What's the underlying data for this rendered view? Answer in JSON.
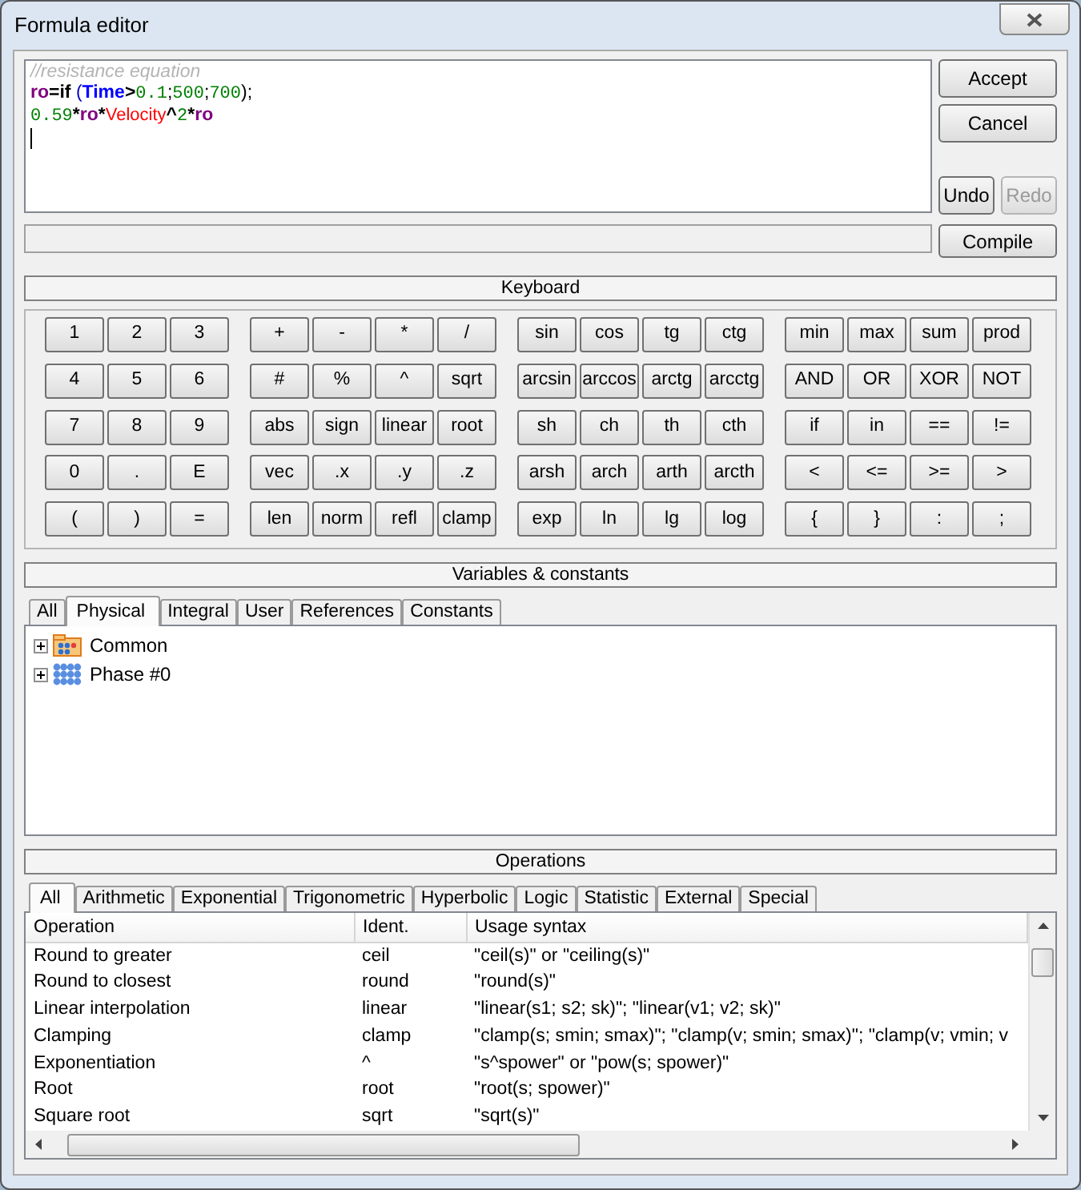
{
  "window": {
    "title": "Formula editor"
  },
  "editor": {
    "lines": [
      [
        {
          "t": "//resistance equation",
          "kind": "comment"
        }
      ],
      [
        {
          "t": "ro",
          "kind": "var"
        },
        {
          "t": "=",
          "kind": "op"
        },
        {
          "t": "if ",
          "kind": "keyword"
        },
        {
          "t": "(",
          "kind": "bracket"
        },
        {
          "t": "Time",
          "kind": "system"
        },
        {
          "t": ">",
          "kind": "op"
        },
        {
          "t": "0.1",
          "kind": "number"
        },
        {
          "t": ";",
          "kind": "sep"
        },
        {
          "t": "500",
          "kind": "number"
        },
        {
          "t": ";",
          "kind": "sep"
        },
        {
          "t": "700",
          "kind": "number"
        },
        {
          "t": ");",
          "kind": "sep"
        }
      ],
      [
        {
          "t": "0.59",
          "kind": "number"
        },
        {
          "t": "*",
          "kind": "op"
        },
        {
          "t": "ro",
          "kind": "var"
        },
        {
          "t": "*",
          "kind": "op"
        },
        {
          "t": "Velocity",
          "kind": "param"
        },
        {
          "t": "^",
          "kind": "op"
        },
        {
          "t": "2",
          "kind": "number"
        },
        {
          "t": "*",
          "kind": "op"
        },
        {
          "t": "ro",
          "kind": "var"
        }
      ]
    ]
  },
  "buttons": {
    "accept": "Accept",
    "cancel": "Cancel",
    "undo": {
      "label": "Undo",
      "disabled": false
    },
    "redo": {
      "label": "Redo",
      "disabled": true
    },
    "compile": "Compile"
  },
  "keyboard": {
    "title": "Keyboard",
    "groups": [
      {
        "rows": [
          [
            "1",
            "2",
            "3"
          ],
          [
            "4",
            "5",
            "6"
          ],
          [
            "7",
            "8",
            "9"
          ],
          [
            "0",
            ".",
            "E"
          ],
          [
            "(",
            ")",
            "="
          ]
        ]
      },
      {
        "rows": [
          [
            "+",
            "-",
            "*",
            "/"
          ],
          [
            "#",
            "%",
            "^",
            "sqrt"
          ],
          [
            "abs",
            "sign",
            "linear",
            "root"
          ],
          [
            "vec",
            ".x",
            ".y",
            ".z"
          ],
          [
            "len",
            "norm",
            "refl",
            "clamp"
          ]
        ]
      },
      {
        "rows": [
          [
            "sin",
            "cos",
            "tg",
            "ctg"
          ],
          [
            "arcsin",
            "arccos",
            "arctg",
            "arcctg"
          ],
          [
            "sh",
            "ch",
            "th",
            "cth"
          ],
          [
            "arsh",
            "arch",
            "arth",
            "arcth"
          ],
          [
            "exp",
            "ln",
            "lg",
            "log"
          ]
        ]
      },
      {
        "rows": [
          [
            "min",
            "max",
            "sum",
            "prod"
          ],
          [
            "AND",
            "OR",
            "XOR",
            "NOT"
          ],
          [
            "if",
            "in",
            "==",
            "!="
          ],
          [
            "<",
            "<=",
            ">=",
            ">"
          ],
          [
            "{",
            "}",
            ":",
            ";"
          ]
        ]
      }
    ]
  },
  "variables": {
    "title": "Variables & constants",
    "tabs": [
      {
        "label": "All",
        "selected": false
      },
      {
        "label": "Physical",
        "selected": true
      },
      {
        "label": "Integral",
        "selected": false
      },
      {
        "label": "User",
        "selected": false
      },
      {
        "label": "References",
        "selected": false
      },
      {
        "label": "Constants",
        "selected": false
      }
    ],
    "tree": [
      {
        "label": "Common",
        "kind": "folder",
        "expanded": false
      },
      {
        "label": "Phase #0",
        "kind": "group",
        "expanded": false
      }
    ]
  },
  "operations": {
    "title": "Operations",
    "tabs": [
      {
        "label": "All",
        "selected": true
      },
      {
        "label": "Arithmetic",
        "selected": false
      },
      {
        "label": "Exponential",
        "selected": false
      },
      {
        "label": "Trigonometric",
        "selected": false
      },
      {
        "label": "Hyperbolic",
        "selected": false
      },
      {
        "label": "Logic",
        "selected": false
      },
      {
        "label": "Statistic",
        "selected": false
      },
      {
        "label": "External",
        "selected": false
      },
      {
        "label": "Special",
        "selected": false
      }
    ],
    "table": {
      "columns": [
        "Operation",
        "Ident.",
        "Usage syntax"
      ],
      "rows": [
        [
          "Round to greater",
          "ceil",
          "\"ceil(s)\" or \"ceiling(s)\""
        ],
        [
          "Round to closest",
          "round",
          "\"round(s)\""
        ],
        [
          "Linear interpolation",
          "linear",
          "\"linear(s1; s2; sk)\"; \"linear(v1; v2; sk)\""
        ],
        [
          "Clamping",
          "clamp",
          "\"clamp(s; smin; smax)\"; \"clamp(v; smin; smax)\"; \"clamp(v; vmin; v"
        ],
        [
          "Exponentiation",
          "^",
          "\"s^spower\" or \"pow(s; spower)\""
        ],
        [
          "Root",
          "root",
          "\"root(s; spower)\""
        ],
        [
          "Square root",
          "sqrt",
          "\"sqrt(s)\""
        ]
      ]
    }
  }
}
